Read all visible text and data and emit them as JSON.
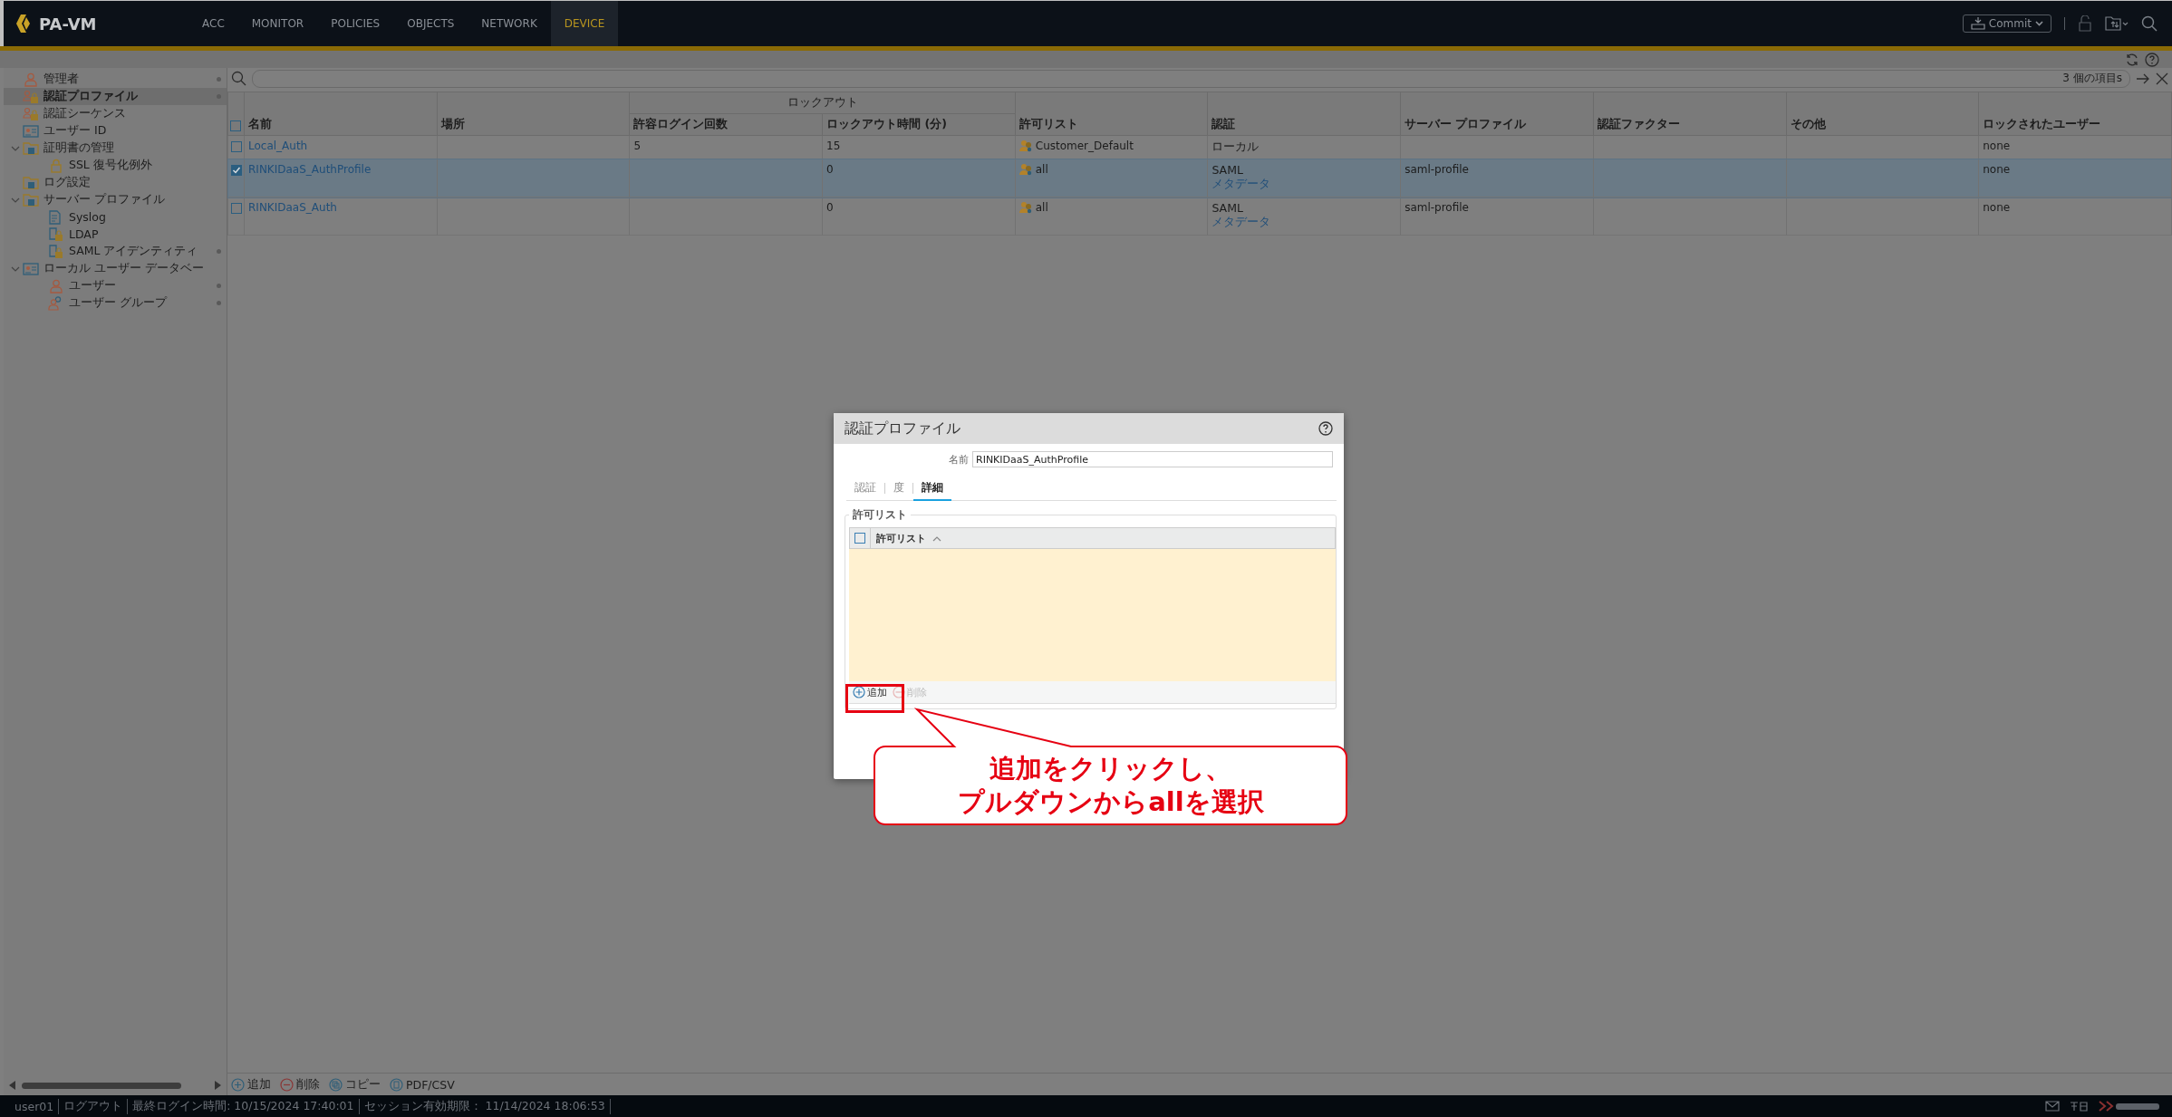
{
  "header": {
    "logo": "PA-VM",
    "nav": [
      {
        "label": "ACC",
        "selected": false
      },
      {
        "label": "MONITOR",
        "selected": false
      },
      {
        "label": "POLICIES",
        "selected": false
      },
      {
        "label": "OBJECTS",
        "selected": false
      },
      {
        "label": "NETWORK",
        "selected": false
      },
      {
        "label": "DEVICE",
        "selected": true
      }
    ],
    "commit": "Commit"
  },
  "sidebar": {
    "items": [
      {
        "label": "管理者",
        "kind": "person",
        "selected": false,
        "dot": true
      },
      {
        "label": "認証プロファイル",
        "kind": "people-lock",
        "selected": true,
        "dot": true
      },
      {
        "label": "認証シーケンス",
        "kind": "people-lock",
        "selected": false,
        "dot": false
      },
      {
        "label": "ユーザー ID",
        "kind": "card",
        "selected": false,
        "dot": false
      },
      {
        "label": "証明書の管理",
        "kind": "folder",
        "selected": false,
        "dot": false,
        "expanded": true,
        "children": [
          {
            "label": "SSL 復号化例外",
            "kind": "lock",
            "selected": false,
            "dot": false
          }
        ]
      },
      {
        "label": "ログ設定",
        "kind": "folder",
        "selected": false,
        "dot": false
      },
      {
        "label": "サーバー プロファイル",
        "kind": "folder",
        "selected": false,
        "dot": false,
        "expanded": true,
        "children": [
          {
            "label": "Syslog",
            "kind": "doc",
            "selected": false,
            "dot": false
          },
          {
            "label": "LDAP",
            "kind": "doc-lock",
            "selected": false,
            "dot": false
          },
          {
            "label": "SAML アイデンティティ",
            "kind": "doc-lock",
            "selected": false,
            "dot": true
          }
        ]
      },
      {
        "label": "ローカル ユーザー データベー",
        "kind": "card",
        "selected": false,
        "dot": false,
        "expanded": true,
        "children": [
          {
            "label": "ユーザー",
            "kind": "person",
            "selected": false,
            "dot": true
          },
          {
            "label": "ユーザー グループ",
            "kind": "people",
            "selected": false,
            "dot": true
          }
        ]
      }
    ]
  },
  "search": {
    "count": "3 個の項目s"
  },
  "table": {
    "all_selected": false,
    "columns": [
      {
        "label": "名前"
      },
      {
        "label": "場所"
      },
      {
        "group": "ロックアウト",
        "columns": [
          "許容ログイン回数",
          "ロックアウト時間 (分)"
        ]
      },
      {
        "label": "許可リスト"
      },
      {
        "label": "認証"
      },
      {
        "label": "サーバー プロファイル"
      },
      {
        "label": "認証ファクター"
      },
      {
        "label": "その他"
      },
      {
        "label": "ロックされたユーザー"
      }
    ],
    "rows": [
      {
        "selected": false,
        "name": "Local_Auth",
        "login_attempts": "5",
        "lockout_time": "15",
        "allow_list": "Customer_Default",
        "authentication": "ローカル",
        "locked_users": "none"
      },
      {
        "selected": true,
        "name": "RINKIDaaS_AuthProfile",
        "lockout_time": "0",
        "allow_list": "all",
        "authentication": "SAML",
        "auth_link": "メタデータ",
        "server_profile": "saml-profile",
        "locked_users": "none"
      },
      {
        "selected": false,
        "name": "RINKIDaaS_Auth",
        "lockout_time": "0",
        "allow_list": "all",
        "authentication": "SAML",
        "auth_link": "メタデータ",
        "server_profile": "saml-profile",
        "locked_users": "none"
      }
    ]
  },
  "toolbar": [
    {
      "label": "追加",
      "kind": "add"
    },
    {
      "label": "削除",
      "kind": "delete"
    },
    {
      "label": "コピー",
      "kind": "copy"
    },
    {
      "label": "PDF/CSV",
      "kind": "export"
    }
  ],
  "status_bar": {
    "user": "user01",
    "logout": "ログアウト",
    "last_login": "最終ログイン時間: 10/15/2024 17:40:01",
    "session": "セッション有効期限： 11/14/2024 18:06:53"
  },
  "dialog": {
    "title": "認証プロファイル",
    "name_label": "名前",
    "name_value": "RINKIDaaS_AuthProfile",
    "tabs": [
      {
        "label": "認証",
        "selected": false
      },
      {
        "label": "度",
        "selected": false
      },
      {
        "label": "詳細",
        "selected": true
      }
    ],
    "section": "許可リスト",
    "grid_column": "許可リスト",
    "grid_checked": false,
    "actions": [
      {
        "label": "追加",
        "kind": "add",
        "disabled": false
      },
      {
        "label": "削除",
        "kind": "delete",
        "disabled": true
      }
    ]
  },
  "callout": {
    "lines": [
      "追加をクリックし、",
      "プルダウンからallを選択"
    ]
  }
}
